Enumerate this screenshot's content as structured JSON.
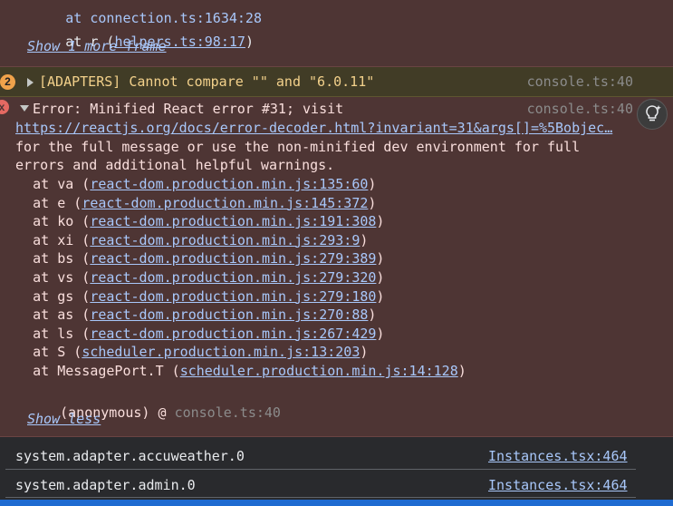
{
  "top_block": {
    "partial_frame": "    at connection.ts:1634:28",
    "frame_prefix": "    at r (",
    "frame_link": "helpers.ts:98:17",
    "frame_suffix": ")",
    "show_more": "Show 1 more frame"
  },
  "warning": {
    "count": "2",
    "message": "[ADAPTERS] Cannot compare \"\" and \"6.0.11\"",
    "source": "console.ts:40"
  },
  "error": {
    "icon": "x",
    "header": "Error: Minified React error #31; visit",
    "source": "console.ts:40",
    "url": "https://reactjs.org/docs/error-decoder.html?invariant=31&args[]=%5Bobjec…",
    "text_line1": "for the full message or use the non-minified dev environment for full",
    "text_line2": "errors and additional helpful warnings.",
    "frames": [
      {
        "fn": "va",
        "link": "react-dom.production.min.js:135:60"
      },
      {
        "fn": "e",
        "link": "react-dom.production.min.js:145:372"
      },
      {
        "fn": "ko",
        "link": "react-dom.production.min.js:191:308"
      },
      {
        "fn": "xi",
        "link": "react-dom.production.min.js:293:9"
      },
      {
        "fn": "bs",
        "link": "react-dom.production.min.js:279:389"
      },
      {
        "fn": "vs",
        "link": "react-dom.production.min.js:279:320"
      },
      {
        "fn": "gs",
        "link": "react-dom.production.min.js:279:180"
      },
      {
        "fn": "as",
        "link": "react-dom.production.min.js:270:88"
      },
      {
        "fn": "ls",
        "link": "react-dom.production.min.js:267:429"
      },
      {
        "fn": "S",
        "link": "scheduler.production.min.js:13:203"
      },
      {
        "fn": "MessagePort.T",
        "link": "scheduler.production.min.js:14:128"
      }
    ],
    "anon_label": "(anonymous) @ ",
    "anon_source": "console.ts:40",
    "show_less": "Show less"
  },
  "rows": [
    {
      "text": "system.adapter.accuweather.0",
      "source": "Instances.tsx:464"
    },
    {
      "text": "system.adapter.admin.0",
      "source": "Instances.tsx:464"
    }
  ],
  "colors": {
    "error_bg": "#4e3534",
    "warning_bg": "#413c26",
    "link": "#a8c7fa"
  },
  "icons": [
    "warning-count-badge",
    "expand-triangle-icon",
    "collapse-triangle-icon",
    "error-x-icon",
    "ai-insight-bulb-icon"
  ]
}
